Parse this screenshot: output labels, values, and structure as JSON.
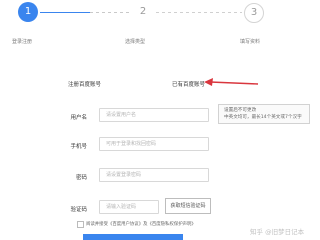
{
  "steps": [
    {
      "number": "1",
      "label": "登录注册"
    },
    {
      "number": "2",
      "label": "选择类型"
    },
    {
      "number": "3",
      "label": "填写资料"
    }
  ],
  "tabs": {
    "register": "注册百度账号",
    "have_account": "已有百度账号"
  },
  "form": {
    "username": {
      "label": "用户名",
      "placeholder": "请设置用户名"
    },
    "phone": {
      "label": "手机号",
      "placeholder": "可用于登录和找回密码"
    },
    "password": {
      "label": "密码",
      "placeholder": "请设置登录密码"
    },
    "code": {
      "label": "验证码",
      "placeholder": "请输入验证码",
      "button": "获取短信验证码"
    }
  },
  "tooltip": {
    "lines": [
      "设置后不可更改",
      "中英文均可，最长14个英文或7个汉字"
    ]
  },
  "agreement": {
    "text": "阅读并接受《百度用户协议》及《百度隐私权保护声明》"
  },
  "watermark": {
    "text": "知乎 @旧梦日记本"
  },
  "colors": {
    "accent": "#3a85ee",
    "arrow": "#d9363e"
  }
}
